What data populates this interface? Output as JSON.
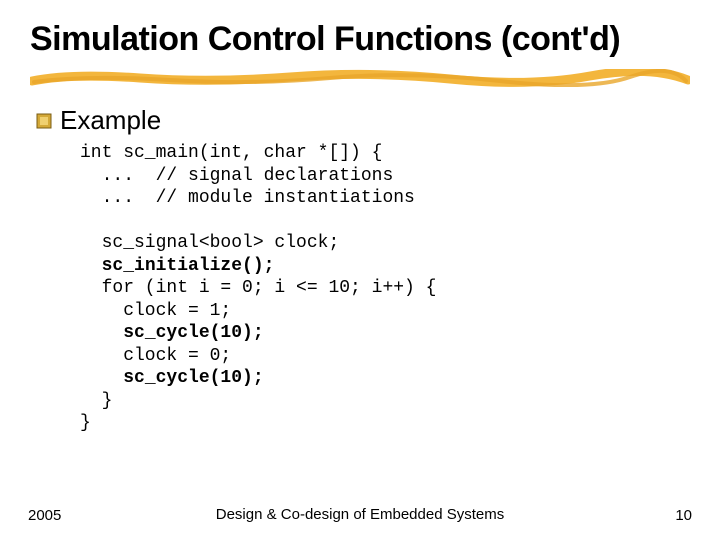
{
  "title": "Simulation Control Functions (cont'd)",
  "bullet": {
    "label": "Example"
  },
  "code": {
    "l01": "int sc_main(int, char *[]) {",
    "l02": "  ...  // signal declarations",
    "l03": "  ...  // module instantiations",
    "l04": "",
    "l05": "  sc_signal<bool> clock;",
    "l06a": "  ",
    "l06b": "sc_initialize();",
    "l07": "  for (int i = 0; i <= 10; i++) {",
    "l08": "    clock = 1;",
    "l09a": "    ",
    "l09b": "sc_cycle(10);",
    "l10": "    clock = 0;",
    "l11a": "    ",
    "l11b": "sc_cycle(10);",
    "l12": "  }",
    "l13": "}"
  },
  "footer": {
    "left": "2005",
    "center": "Design & Co-design of Embedded Systems",
    "right": "10"
  }
}
